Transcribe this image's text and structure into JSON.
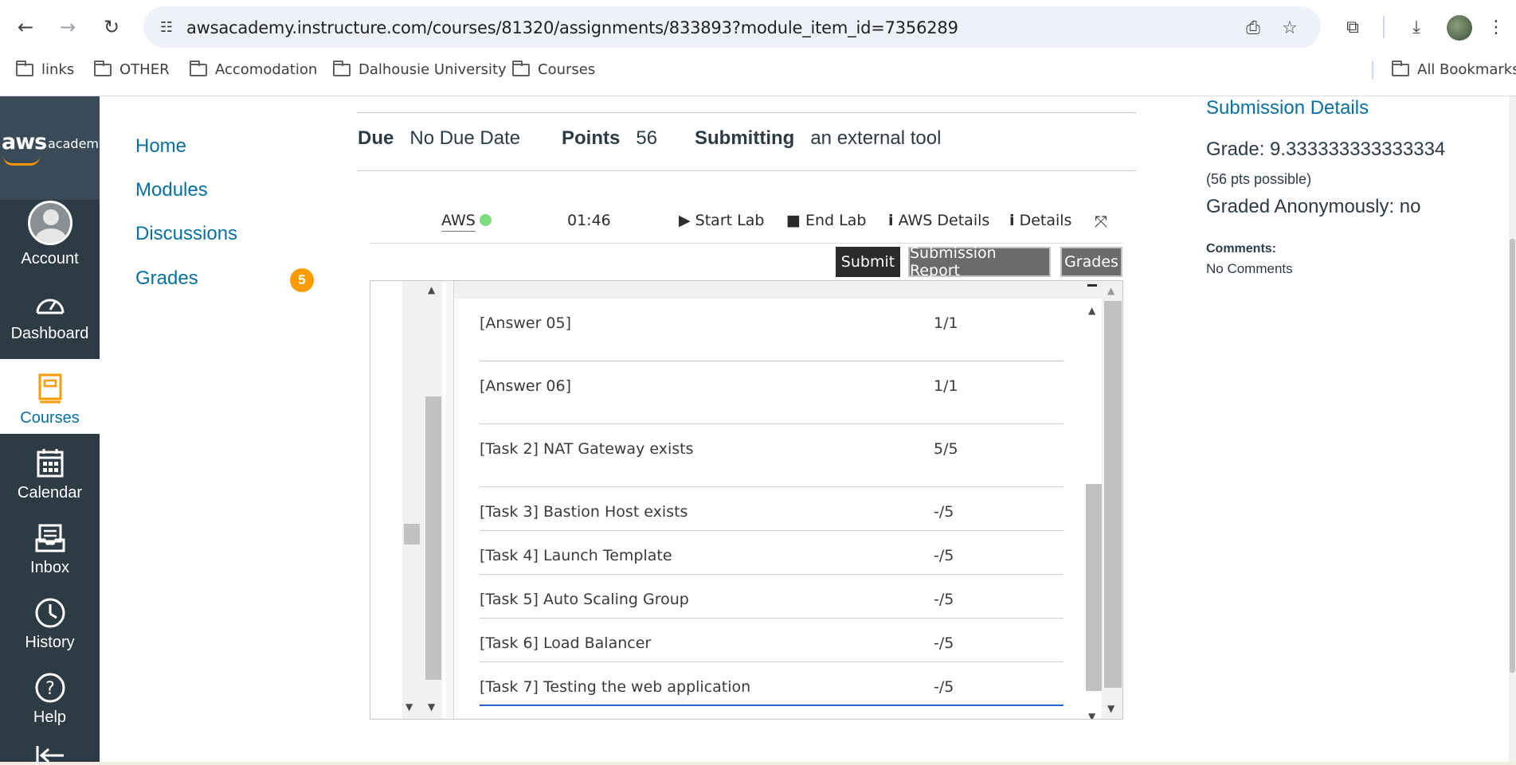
{
  "browser": {
    "url": "awsacademy.instructure.com/courses/81320/assignments/833893?module_item_id=7356289",
    "bookmarks": [
      "links",
      "OTHER",
      "Accomodation",
      "Dalhousie University",
      "Courses"
    ],
    "all_bookmarks": "All Bookmarks"
  },
  "global_nav": {
    "logo_main": "aws",
    "logo_sub": "academy",
    "items": [
      "Account",
      "Dashboard",
      "Courses",
      "Calendar",
      "Inbox",
      "History",
      "Help"
    ]
  },
  "course_nav": {
    "items": [
      "Home",
      "Modules",
      "Discussions",
      "Grades"
    ],
    "grades_badge": "5"
  },
  "assignment": {
    "due_label": "Due",
    "due_value": "No Due Date",
    "points_label": "Points",
    "points_value": "56",
    "submitting_label": "Submitting",
    "submitting_value": "an external tool"
  },
  "lab": {
    "aws_label": "AWS",
    "aws_status_color": "#7ddc7d",
    "timer": "01:46",
    "start_lab": "Start Lab",
    "end_lab": "End Lab",
    "aws_details": "AWS Details",
    "details": "Details",
    "submit": "Submit",
    "submission_report": "Submission Report",
    "grades": "Grades",
    "rows": [
      {
        "task": "[Answer 05]",
        "score": "1/1"
      },
      {
        "task": "[Answer 06]",
        "score": "1/1"
      },
      {
        "task": "[Task 2] NAT Gateway exists",
        "score": "5/5"
      },
      {
        "task": "[Task 3] Bastion Host exists",
        "score": "-/5"
      },
      {
        "task": "[Task 4] Launch Template",
        "score": "-/5"
      },
      {
        "task": "[Task 5] Auto Scaling Group",
        "score": "-/5"
      },
      {
        "task": "[Task 6] Load Balancer",
        "score": "-/5"
      },
      {
        "task": "[Task 7] Testing the web application",
        "score": "-/5"
      }
    ]
  },
  "submission": {
    "title": "Submission Details",
    "grade": "Grade: 9.333333333333334",
    "possible": "(56 pts possible)",
    "anonymous": "Graded Anonymously: no",
    "comments_label": "Comments:",
    "comments_value": "No Comments"
  },
  "colors": {
    "nav_bg": "#2d3b45",
    "link": "#0770a3",
    "badge": "#fc9b00",
    "aws_orange": "#ff9900"
  }
}
